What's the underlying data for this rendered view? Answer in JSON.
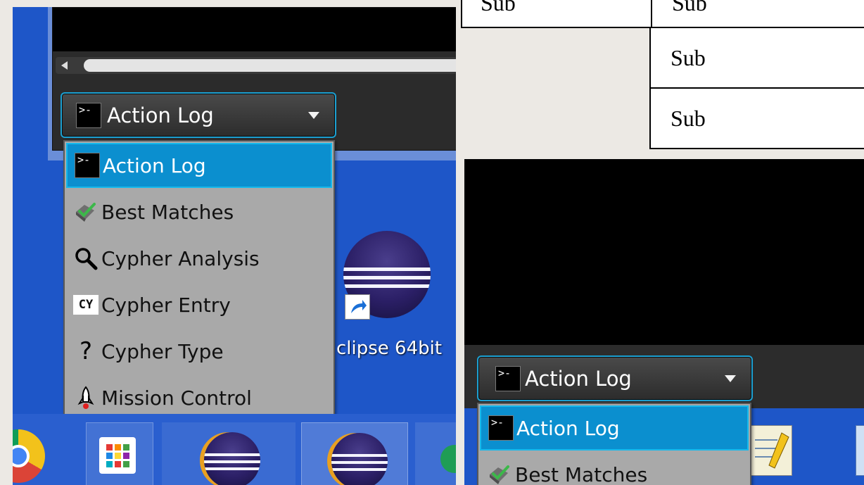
{
  "left_panel": {
    "dropdown_selected": "Action Log",
    "menu_items": [
      {
        "label": "Action Log",
        "icon": "terminal-icon",
        "selected": true
      },
      {
        "label": "Best Matches",
        "icon": "check-gem-icon",
        "selected": false
      },
      {
        "label": "Cypher Analysis",
        "icon": "magnifier-icon",
        "selected": false
      },
      {
        "label": "Cypher Entry",
        "icon": "cy-icon",
        "selected": false
      },
      {
        "label": "Cypher Type",
        "icon": "question-icon",
        "selected": false
      },
      {
        "label": "Mission Control",
        "icon": "rocket-icon",
        "selected": false
      }
    ],
    "desktop_shortcut_label": "clipse 64bit",
    "taskbar_icons": [
      "chrome-icon",
      "app-grid-icon",
      "eclipse-icon",
      "eclipse-icon"
    ]
  },
  "top_table": {
    "cells": [
      "Sub",
      "Sub",
      "Sub",
      "Sub"
    ]
  },
  "right_panel": {
    "dropdown_selected": "Action Log",
    "menu_items": [
      {
        "label": "Action Log",
        "icon": "terminal-icon",
        "selected": true
      },
      {
        "label": "Best Matches",
        "icon": "check-gem-icon",
        "selected": false
      }
    ]
  },
  "colors": {
    "accent_blue": "#0b8fcf",
    "desktop_blue": "#1e56c8",
    "menu_grey": "#a9a9a9"
  },
  "terminal_glyph": ">-"
}
